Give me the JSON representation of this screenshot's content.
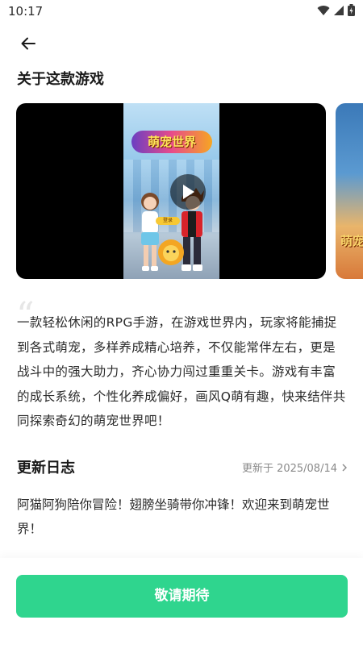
{
  "status_bar": {
    "time": "10:17",
    "icons": [
      "wifi-icon",
      "signal-icon",
      "battery-icon"
    ]
  },
  "header": {
    "back_icon": "arrow-left-icon"
  },
  "about": {
    "title": "关于这款游戏",
    "media": {
      "video_logo": "萌宠世界",
      "video_button": "登录",
      "screenshot_text": "萌宠"
    },
    "description": "一款轻松休闲的RPG手游，在游戏世界内，玩家将能捕捉到各式萌宠，多样养成精心培养，不仅能常伴左右，更是战斗中的强大助力，齐心协力闯过重重关卡。游戏有丰富的成长系统，个性化养成偏好，画风Q萌有趣，快来结伴共同探索奇幻的萌宠世界吧！"
  },
  "changelog": {
    "title": "更新日志",
    "date": "更新于 2025/08/14",
    "text": "阿猫阿狗陪你冒险！翅膀坐骑带你冲锋！欢迎来到萌宠世界！"
  },
  "cta": {
    "label": "敬请期待"
  },
  "colors": {
    "accent": "#2fd58e",
    "muted_text": "#8a8a8a"
  }
}
